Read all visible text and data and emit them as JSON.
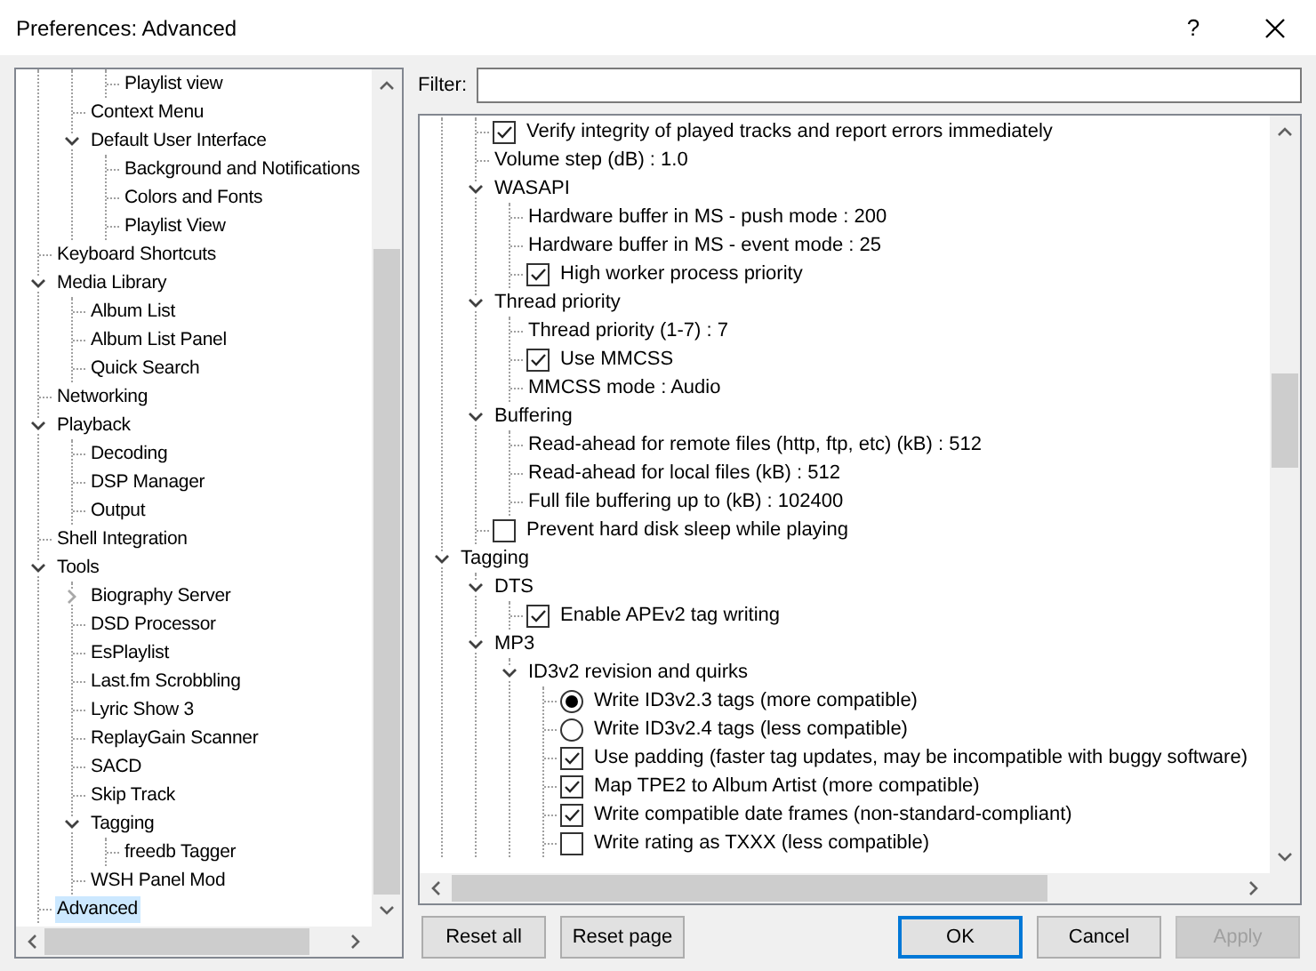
{
  "window": {
    "title": "Preferences: Advanced",
    "help": "?"
  },
  "sidebar": {
    "tree": [
      {
        "children": [
          {
            "children": [
              {
                "label": "Playlist view",
                "selected": false
              }
            ]
          },
          {
            "label": "Context Menu",
            "selected": false
          },
          {
            "label": "Default User Interface",
            "selected": false,
            "expanded": true,
            "children": [
              {
                "label": "Background and Notifications",
                "selected": false
              },
              {
                "label": "Colors and Fonts",
                "selected": false
              },
              {
                "label": "Playlist View",
                "selected": false
              }
            ]
          }
        ]
      },
      {
        "label": "Keyboard Shortcuts",
        "selected": false
      },
      {
        "label": "Media Library",
        "selected": false,
        "expanded": true,
        "children": [
          {
            "label": "Album List",
            "selected": false
          },
          {
            "label": "Album List Panel",
            "selected": false
          },
          {
            "label": "Quick Search",
            "selected": false
          }
        ]
      },
      {
        "label": "Networking",
        "selected": false
      },
      {
        "label": "Playback",
        "selected": false,
        "expanded": true,
        "children": [
          {
            "label": "Decoding",
            "selected": false
          },
          {
            "label": "DSP Manager",
            "selected": false
          },
          {
            "label": "Output",
            "selected": false
          }
        ]
      },
      {
        "label": "Shell Integration",
        "selected": false
      },
      {
        "label": "Tools",
        "selected": false,
        "expanded": true,
        "children": [
          {
            "label": "Biography Server",
            "selected": false,
            "expanded": false
          },
          {
            "label": "DSD Processor",
            "selected": false
          },
          {
            "label": "EsPlaylist",
            "selected": false
          },
          {
            "label": "Last.fm Scrobbling",
            "selected": false
          },
          {
            "label": "Lyric Show 3",
            "selected": false
          },
          {
            "label": "ReplayGain Scanner",
            "selected": false
          },
          {
            "label": "SACD",
            "selected": false
          },
          {
            "label": "Skip Track",
            "selected": false
          },
          {
            "label": "Tagging",
            "selected": false,
            "expanded": true,
            "children": [
              {
                "label": "freedb Tagger",
                "selected": false
              }
            ]
          },
          {
            "label": "WSH Panel Mod",
            "selected": false
          }
        ]
      },
      {
        "label": "Advanced",
        "selected": true
      }
    ]
  },
  "filter": {
    "label": "Filter:"
  },
  "settings": {
    "tree": [
      {
        "children": [
          {
            "kind": "checkbox",
            "label": "Verify integrity of played tracks and report errors immediately",
            "checked": true
          },
          {
            "kind": "value",
            "label": "Volume step (dB) : 1.0"
          },
          {
            "kind": "group",
            "label": "WASAPI",
            "expanded": true,
            "children": [
              {
                "kind": "value",
                "label": "Hardware buffer in MS - push mode : 200"
              },
              {
                "kind": "value",
                "label": "Hardware buffer in MS - event mode : 25"
              },
              {
                "kind": "checkbox",
                "label": "High worker process priority",
                "checked": true
              }
            ]
          },
          {
            "kind": "group",
            "label": "Thread priority",
            "expanded": true,
            "children": [
              {
                "kind": "value",
                "label": "Thread priority (1-7) : 7"
              },
              {
                "kind": "checkbox",
                "label": "Use MMCSS",
                "checked": true
              },
              {
                "kind": "value",
                "label": "MMCSS mode : Audio"
              }
            ]
          },
          {
            "kind": "group",
            "label": "Buffering",
            "expanded": true,
            "children": [
              {
                "kind": "value",
                "label": "Read-ahead for remote files (http, ftp, etc) (kB) : 512"
              },
              {
                "kind": "value",
                "label": "Read-ahead for local files (kB) : 512"
              },
              {
                "kind": "value",
                "label": "Full file buffering up to (kB) : 102400"
              }
            ]
          },
          {
            "kind": "checkbox",
            "label": "Prevent hard disk sleep while playing",
            "checked": false
          }
        ]
      },
      {
        "kind": "group",
        "label": "Tagging",
        "expanded": true,
        "children": [
          {
            "kind": "group",
            "label": "DTS",
            "expanded": true,
            "children": [
              {
                "kind": "checkbox",
                "label": "Enable APEv2 tag writing",
                "checked": true
              }
            ]
          },
          {
            "kind": "group",
            "label": "MP3",
            "expanded": true,
            "children": [
              {
                "kind": "group",
                "label": "ID3v2 revision and quirks",
                "expanded": true,
                "children": [
                  {
                    "kind": "radio",
                    "label": "Write ID3v2.3 tags (more compatible)",
                    "selected": true
                  },
                  {
                    "kind": "radio",
                    "label": "Write ID3v2.4 tags (less compatible)",
                    "selected": false
                  },
                  {
                    "kind": "checkbox",
                    "label": "Use padding (faster tag updates, may be incompatible with buggy software)",
                    "checked": true
                  },
                  {
                    "kind": "checkbox",
                    "label": "Map TPE2 to Album Artist (more compatible)",
                    "checked": true
                  },
                  {
                    "kind": "checkbox",
                    "label": "Write compatible date frames (non-standard-compliant)",
                    "checked": true
                  },
                  {
                    "kind": "checkbox",
                    "label": "Write rating as TXXX (less compatible)",
                    "checked": false
                  }
                ]
              }
            ]
          }
        ]
      }
    ]
  },
  "buttons": [
    {
      "label": "Reset all",
      "default": false,
      "disabled": false
    },
    {
      "label": "Reset page",
      "default": false,
      "disabled": false
    },
    {
      "label": "OK",
      "default": true,
      "disabled": false
    },
    {
      "label": "Cancel",
      "default": false,
      "disabled": false
    },
    {
      "label": "Apply",
      "default": false,
      "disabled": true
    }
  ]
}
